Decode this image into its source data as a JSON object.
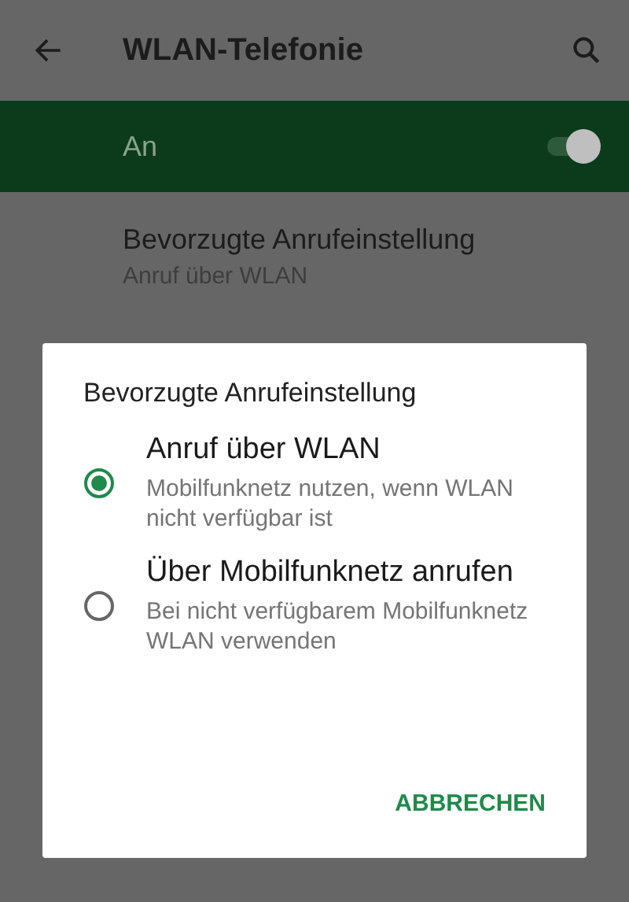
{
  "app_bar": {
    "title": "WLAN-Telefonie"
  },
  "master_switch": {
    "label": "An",
    "on": true
  },
  "settings": [
    {
      "title": "Bevorzugte Anrufeinstellung",
      "summary": "Anruf über WLAN"
    }
  ],
  "dialog": {
    "title": "Bevorzugte Anrufeinstellung",
    "options": [
      {
        "label": "Anruf über WLAN",
        "description": "Mobilfunknetz nutzen, wenn WLAN nicht verfügbar ist",
        "selected": true
      },
      {
        "label": "Über Mobilfunknetz anrufen",
        "description": "Bei nicht verfügbarem Mobilfunknetz WLAN verwenden",
        "selected": false
      }
    ],
    "buttons": [
      "ABBRECHEN"
    ]
  }
}
